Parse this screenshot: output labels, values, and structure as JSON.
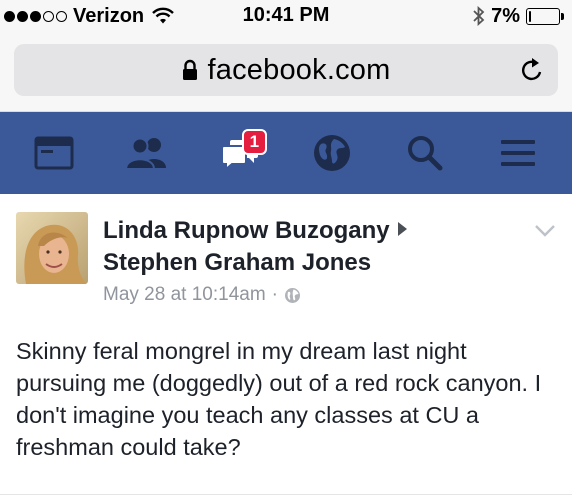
{
  "status_bar": {
    "carrier": "Verizon",
    "time": "10:41 PM",
    "battery_percent": "7%",
    "battery_level": 0.07,
    "signal_bars_filled": 3,
    "signal_bars_total": 5
  },
  "browser": {
    "url": "facebook.com",
    "icons": [
      "lock-icon",
      "reload-icon"
    ]
  },
  "nav": {
    "items": [
      {
        "name": "news-feed",
        "icon": "news-feed-icon"
      },
      {
        "name": "friend-requests",
        "icon": "friends-icon"
      },
      {
        "name": "messages",
        "icon": "messages-icon",
        "badge": "1"
      },
      {
        "name": "notifications",
        "icon": "globe-icon"
      },
      {
        "name": "search",
        "icon": "search-icon"
      },
      {
        "name": "menu",
        "icon": "hamburger-menu-icon"
      }
    ],
    "background": "#3b5998",
    "badge_color": "#e41e3f"
  },
  "post": {
    "author": "Linda Rupnow Buzogany",
    "recipient": "Stephen Graham Jones",
    "timestamp": "May 28 at 10:14am",
    "separator": "·",
    "privacy_icon": "globe-icon",
    "text": "Skinny feral mongrel in my dream last night pursuing me (doggedly) out of a red rock canyon. I don't imagine you teach any classes at CU a freshman could take?"
  }
}
